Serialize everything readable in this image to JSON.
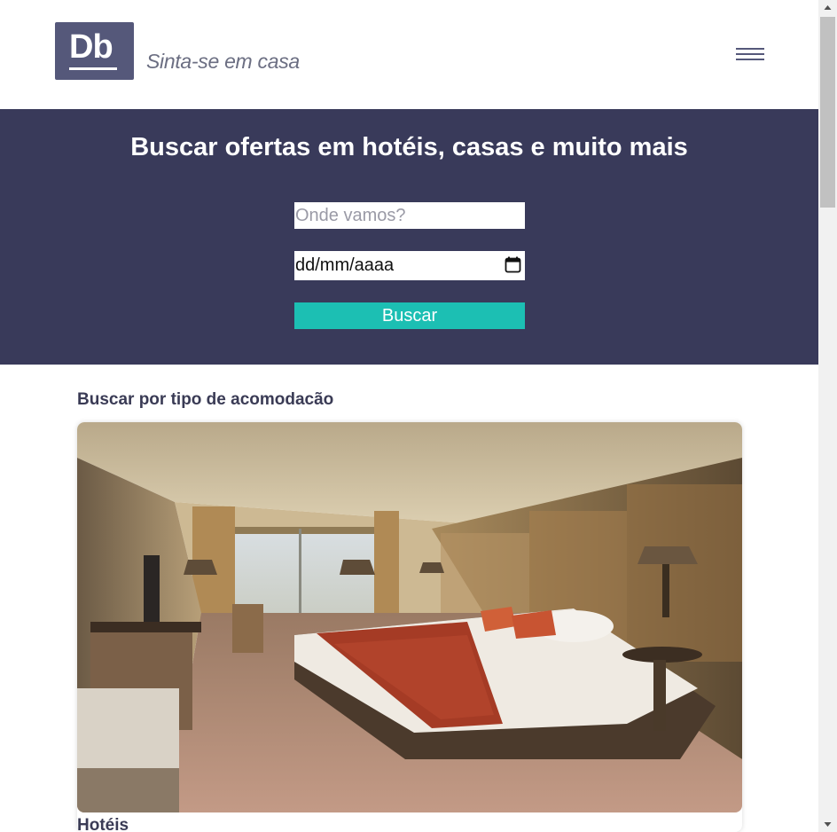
{
  "header": {
    "logo_text": "Db",
    "tagline": "Sinta-se em casa"
  },
  "hero": {
    "title": "Buscar ofertas em hotéis, casas e muito mais",
    "destination_placeholder": "Onde vamos?",
    "date_placeholder": "dd/mm/aaaa",
    "search_button": "Buscar"
  },
  "section": {
    "title": "Buscar por tipo de acomodacão",
    "cards": [
      {
        "label": "Hotéis"
      }
    ]
  },
  "colors": {
    "hero_bg": "#393a5a",
    "accent": "#1cbfb3",
    "logo_bg": "#55587a",
    "heading": "#3a3b55"
  },
  "icons": [
    "menu-icon",
    "calendar-icon",
    "scroll-up-arrow",
    "scroll-down-arrow"
  ]
}
